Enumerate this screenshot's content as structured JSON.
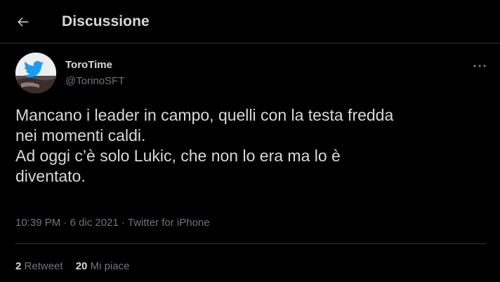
{
  "header": {
    "title": "Discussione",
    "back_icon": "arrow-left-icon"
  },
  "tweet": {
    "author_name": "ToroTime",
    "author_handle": "@TorinoSFT",
    "avatar_icon": "twitter-bird-icon",
    "more_icon": "more-horizontal-icon",
    "text_lines": [
      "Mancano i leader in campo, quelli con la testa fredda",
      "nei momenti caldi.",
      "Ad oggi c’è solo Lukic, che non lo era ma lo è",
      "diventato."
    ],
    "time": "10:39 PM",
    "date": "6 dic 2021",
    "separator": "·",
    "source": "Twitter for iPhone"
  },
  "stats": {
    "retweets_count": "2",
    "retweets_label": "Retweet",
    "likes_count": "20",
    "likes_label": "Mi piace"
  },
  "colors": {
    "background": "#000000",
    "text_primary": "#d9d9d9",
    "text_secondary": "#6e767d",
    "border": "#2f3336",
    "twitter_blue": "#1d9bf0"
  }
}
